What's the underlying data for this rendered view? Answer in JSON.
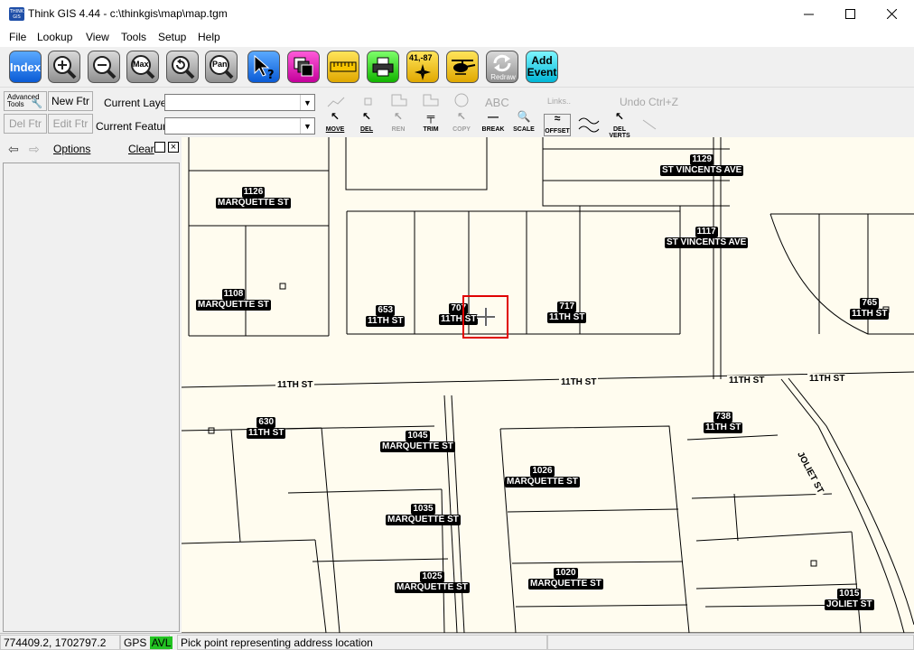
{
  "window": {
    "title": "Think GIS 4.44 - c:\\thinkgis\\map\\map.tgm"
  },
  "menu": [
    "File",
    "Lookup",
    "View",
    "Tools",
    "Setup",
    "Help"
  ],
  "toolbar": {
    "index_label": "Index",
    "max_label": "Max",
    "pan_label": "Pan",
    "dms_label": "41,-87",
    "redraw_label": "Redraw",
    "add_event_label": "Add Event",
    "search_value": ""
  },
  "edit_toolbar": {
    "advanced_tools": "Advanced Tools",
    "new_ftr": "New Ftr",
    "del_ftr": "Del Ftr",
    "edit_ftr": "Edit Ftr",
    "current_layer_label": "Current Layer",
    "current_feature_label": "Current Feature",
    "current_layer_value": "",
    "current_feature_value": "",
    "abc": "ABC",
    "links": "Links..",
    "undo": "Undo",
    "undo_shortcut": "Ctrl+Z",
    "tools": [
      "MOVE",
      "DEL",
      "REN",
      "TRIM",
      "COPY",
      "BREAK",
      "SCALE",
      "OFFSET",
      "DEL VERTS"
    ]
  },
  "left_pane": {
    "options": "Options",
    "clear": "Clear"
  },
  "map": {
    "street_labels": [
      "11TH ST",
      "11TH ST",
      "11TH ST",
      "11TH ST",
      "JOLIET ST"
    ],
    "parcels": [
      {
        "num": "1129",
        "street": "ST VINCENTS AVE"
      },
      {
        "num": "1126",
        "street": "MARQUETTE ST"
      },
      {
        "num": "1117",
        "street": "ST VINCENTS AVE"
      },
      {
        "num": "1108",
        "street": "MARQUETTE ST"
      },
      {
        "num": "653",
        "street": "11TH ST"
      },
      {
        "num": "707",
        "street": "11TH ST"
      },
      {
        "num": "717",
        "street": "11TH ST"
      },
      {
        "num": "765",
        "street": "11TH ST"
      },
      {
        "num": "630",
        "street": "11TH ST"
      },
      {
        "num": "1045",
        "street": "MARQUETTE ST"
      },
      {
        "num": "738",
        "street": "11TH ST"
      },
      {
        "num": "1026",
        "street": "MARQUETTE ST"
      },
      {
        "num": "1035",
        "street": "MARQUETTE ST"
      },
      {
        "num": "1025",
        "street": "MARQUETTE ST"
      },
      {
        "num": "1020",
        "street": "MARQUETTE ST"
      },
      {
        "num": "1015",
        "street": "JOLIET ST"
      }
    ]
  },
  "status": {
    "coords": "774409.2, 1702797.2",
    "gps": "GPS",
    "avl": "AVL",
    "message": "Pick point representing address location"
  }
}
